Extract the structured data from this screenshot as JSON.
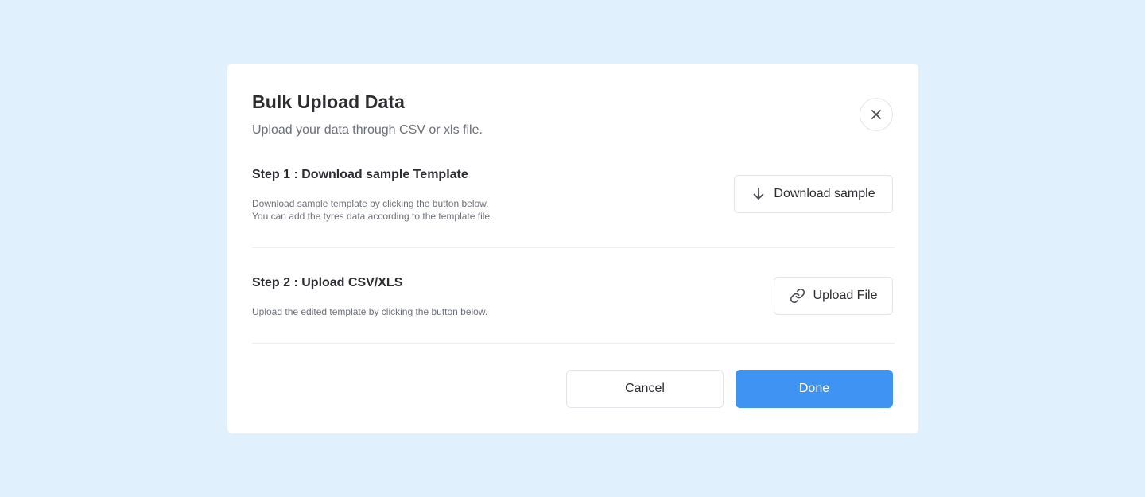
{
  "modal": {
    "title": "Bulk Upload Data",
    "subtitle": "Upload your data through CSV or xls file."
  },
  "step1": {
    "title": "Step 1 : Download sample Template",
    "desc_line1": "Download sample template by clicking the button below.",
    "desc_line2": "You can add the tyres data according to the template file.",
    "button_label": "Download sample",
    "button_icon": "arrow-down-icon"
  },
  "step2": {
    "title": "Step 2 : Upload CSV/XLS",
    "desc_line1": "Upload the edited template by clicking the button below.",
    "button_label": "Upload File",
    "button_icon": "link-icon"
  },
  "footer": {
    "cancel_label": "Cancel",
    "done_label": "Done"
  },
  "colors": {
    "background": "#e1f0fd",
    "primary": "#3e93f3",
    "text": "#2b2d31",
    "muted": "#6b6f76"
  }
}
